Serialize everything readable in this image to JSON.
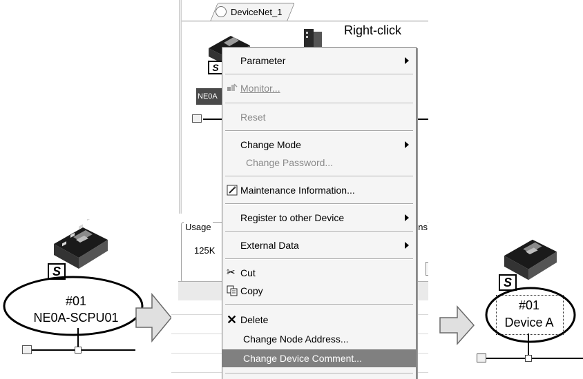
{
  "left_device": {
    "node_number": "#01",
    "comment": "NE0A-SCPU01",
    "badge_letter": "S"
  },
  "center": {
    "tab_label": "DeviceNet_1",
    "annotation": "Right-click",
    "device_chip_label": "NE0A",
    "usage_label": "Usage",
    "speed_label": "125K",
    "options_fragment": "ons",
    "badge_letter": "S",
    "menu": {
      "items": [
        {
          "label": "Parameter",
          "enabled": true,
          "submenu": true
        },
        {
          "label": "Monitor...",
          "enabled": false,
          "submenu": false,
          "icon": "monitor-icon"
        },
        {
          "label": "Reset",
          "enabled": false,
          "submenu": false
        },
        {
          "label": "Change Mode",
          "enabled": true,
          "submenu": true
        },
        {
          "label": "Change Password...",
          "enabled": false,
          "submenu": false
        },
        {
          "label": "Maintenance Information...",
          "enabled": true,
          "submenu": false,
          "icon": "maintenance-icon"
        },
        {
          "label": "Register to other Device",
          "enabled": true,
          "submenu": true
        },
        {
          "label": "External Data",
          "enabled": true,
          "submenu": true
        },
        {
          "label": "Cut",
          "enabled": true,
          "submenu": false,
          "icon": "scissors-icon"
        },
        {
          "label": "Copy",
          "enabled": true,
          "submenu": false,
          "icon": "copy-icon"
        },
        {
          "label": "Delete",
          "enabled": true,
          "submenu": false,
          "icon": "delete-x-icon"
        },
        {
          "label": "Change Node Address...",
          "enabled": true,
          "submenu": false
        },
        {
          "label": "Change Device Comment...",
          "enabled": true,
          "submenu": false,
          "highlighted": true
        }
      ]
    }
  },
  "right_device": {
    "node_number": "#01",
    "comment": "Device A",
    "badge_letter": "S"
  },
  "colors": {
    "highlight": "#808080",
    "menu_bg": "#f5f5f5",
    "disabled_text": "#8a8a8a",
    "arrow_fill": "#e0e0e0"
  }
}
